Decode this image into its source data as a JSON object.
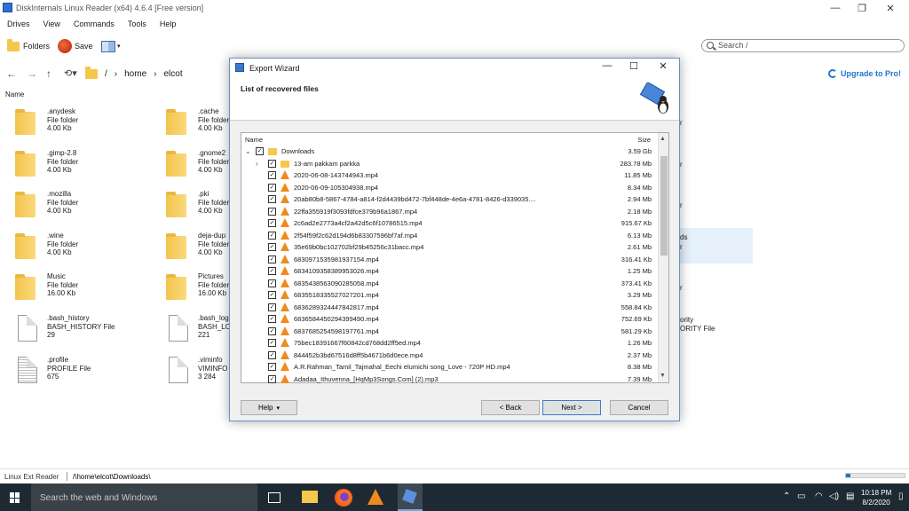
{
  "app": {
    "title": "DiskInternals Linux Reader (x64) 4.6.4 [Free version]",
    "window_controls": [
      "—",
      "❐",
      "✕"
    ]
  },
  "menu": [
    "Drives",
    "View",
    "Commands",
    "Tools",
    "Help"
  ],
  "toolbar": {
    "folders_label": "Folders",
    "save_label": "Save"
  },
  "search": {
    "placeholder": "Search /"
  },
  "nav": {
    "root": "/",
    "path": [
      "home",
      "elcot"
    ]
  },
  "upgrade_label": "Upgrade to Pro!",
  "column_header": "Name",
  "items": [
    {
      "name": ".anydesk",
      "type": "File folder",
      "size": "4.00 Kb",
      "icon": "folder"
    },
    {
      "name": ".cache",
      "type": "File folder",
      "size": "4.00 Kb",
      "icon": "folder"
    },
    {
      "name": ".gimp-2.8",
      "type": "File folder",
      "size": "4.00 Kb",
      "icon": "folder"
    },
    {
      "name": ".gnome2",
      "type": "File folder",
      "size": "4.00 Kb",
      "icon": "folder"
    },
    {
      "name": ".mozilla",
      "type": "File folder",
      "size": "4.00 Kb",
      "icon": "folder"
    },
    {
      "name": ".pki",
      "type": "File folder",
      "size": "4.00 Kb",
      "icon": "folder"
    },
    {
      "name": ".wine",
      "type": "File folder",
      "size": "4.00 Kb",
      "icon": "folder"
    },
    {
      "name": "deja-dup",
      "type": "File folder",
      "size": "4.00 Kb",
      "icon": "folder"
    },
    {
      "name": "Music",
      "type": "File folder",
      "size": "16.00 Kb",
      "icon": "folder"
    },
    {
      "name": "Pictures",
      "type": "File folder",
      "size": "16.00 Kb",
      "icon": "folder"
    },
    {
      "name": ".bash_history",
      "type": "BASH_HISTORY File",
      "size": "29",
      "icon": "doc"
    },
    {
      "name": ".bash_log",
      "type": "BASH_LO",
      "size": "221",
      "icon": "doc"
    },
    {
      "name": ".profile",
      "type": "PROFILE File",
      "size": "675",
      "icon": "doc-lines"
    },
    {
      "name": ".viminfo",
      "type": "VIMINFO",
      "size": "3 284",
      "icon": "doc"
    }
  ],
  "partial_right": [
    "r",
    "r",
    "r",
    "r",
    "ds",
    "r",
    "ority",
    "ORITY File"
  ],
  "status": {
    "drive": "Linux Ext Reader",
    "path": "/\\home\\elcot\\Downloads\\",
    "progress": 0.07
  },
  "taskbar": {
    "search_placeholder": "Search the web and Windows",
    "time": "10:18 PM",
    "date": "8/2/2020"
  },
  "dialog": {
    "title": "Export Wizard",
    "heading": "List of recovered files",
    "col_name": "Name",
    "col_size": "Size",
    "rows": [
      {
        "name": "Downloads",
        "size": "3.59 Gb",
        "icon": "folder",
        "level": 0,
        "expander": "v"
      },
      {
        "name": "13-am pakkam parkka",
        "size": "283.78 Mb",
        "icon": "folder",
        "level": 1,
        "expander": ">"
      },
      {
        "name": "2020-06-08-143744943.mp4",
        "size": "11.85 Mb",
        "icon": "vlc",
        "level": 1
      },
      {
        "name": "2020-06-09-105304938.mp4",
        "size": "8.34 Mb",
        "icon": "vlc",
        "level": 1
      },
      {
        "name": "20ab80b8-5867-4784-a814-f2d4439bd472-7bf448de-4e6a-4781-8426-d339035....",
        "size": "2.94 Mb",
        "icon": "vlc",
        "level": 1
      },
      {
        "name": "22ffa355919f3093fdfce379b96a1867.mp4",
        "size": "2.18 Mb",
        "icon": "vlc",
        "level": 1
      },
      {
        "name": "2c6ad2e2773a4cf2a42d5c6f10786515.mp4",
        "size": "915.67 Kb",
        "icon": "vlc",
        "level": 1
      },
      {
        "name": "2f54f59f2c62d194d6b83307596bf7af.mp4",
        "size": "6.13 Mb",
        "icon": "vlc",
        "level": 1
      },
      {
        "name": "35e69b0bc102702bf29b45256c31bacc.mp4",
        "size": "2.61 Mb",
        "icon": "vlc",
        "level": 1
      },
      {
        "name": "6830971535981937154.mp4",
        "size": "316.41 Kb",
        "icon": "vlc",
        "level": 1
      },
      {
        "name": "6834109358389953026.mp4",
        "size": "1.25 Mb",
        "icon": "vlc",
        "level": 1
      },
      {
        "name": "6835438563090285058.mp4",
        "size": "373.41 Kb",
        "icon": "vlc",
        "level": 1
      },
      {
        "name": "6835518335527027201.mp4",
        "size": "3.29 Mb",
        "icon": "vlc",
        "level": 1
      },
      {
        "name": "6836289324447842817.mp4",
        "size": "558.84 Kb",
        "icon": "vlc",
        "level": 1
      },
      {
        "name": "6836584450294399490.mp4",
        "size": "752.69 Kb",
        "icon": "vlc",
        "level": 1
      },
      {
        "name": "6837685254598197761.mp4",
        "size": "581.29 Kb",
        "icon": "vlc",
        "level": 1
      },
      {
        "name": "75bec18391667f60842cd768dd2ff5ed.mp4",
        "size": "1.26 Mb",
        "icon": "vlc",
        "level": 1
      },
      {
        "name": "844452b3bd67516d8ff5b4671b6d0ece.mp4",
        "size": "2.37 Mb",
        "icon": "vlc",
        "level": 1
      },
      {
        "name": "A.R.Rahman_Tamil_Tajmahal_Eechi elumichi song_Love - 720P HD.mp4",
        "size": "8.38 Mb",
        "icon": "vlc",
        "level": 1
      },
      {
        "name": "Adadaa_Ithuvenna_[HqMp3Songs.Com] (2).mp3",
        "size": "7.39 Mb",
        "icon": "vlc",
        "level": 1
      }
    ],
    "buttons": {
      "help": "Help",
      "back": "< Back",
      "next": "Next >",
      "cancel": "Cancel"
    }
  },
  "colors": {
    "accent": "#1f76d2",
    "folder": "#f5c84c",
    "vlc": "#f08a1c",
    "taskbar": "#1e2a33"
  }
}
